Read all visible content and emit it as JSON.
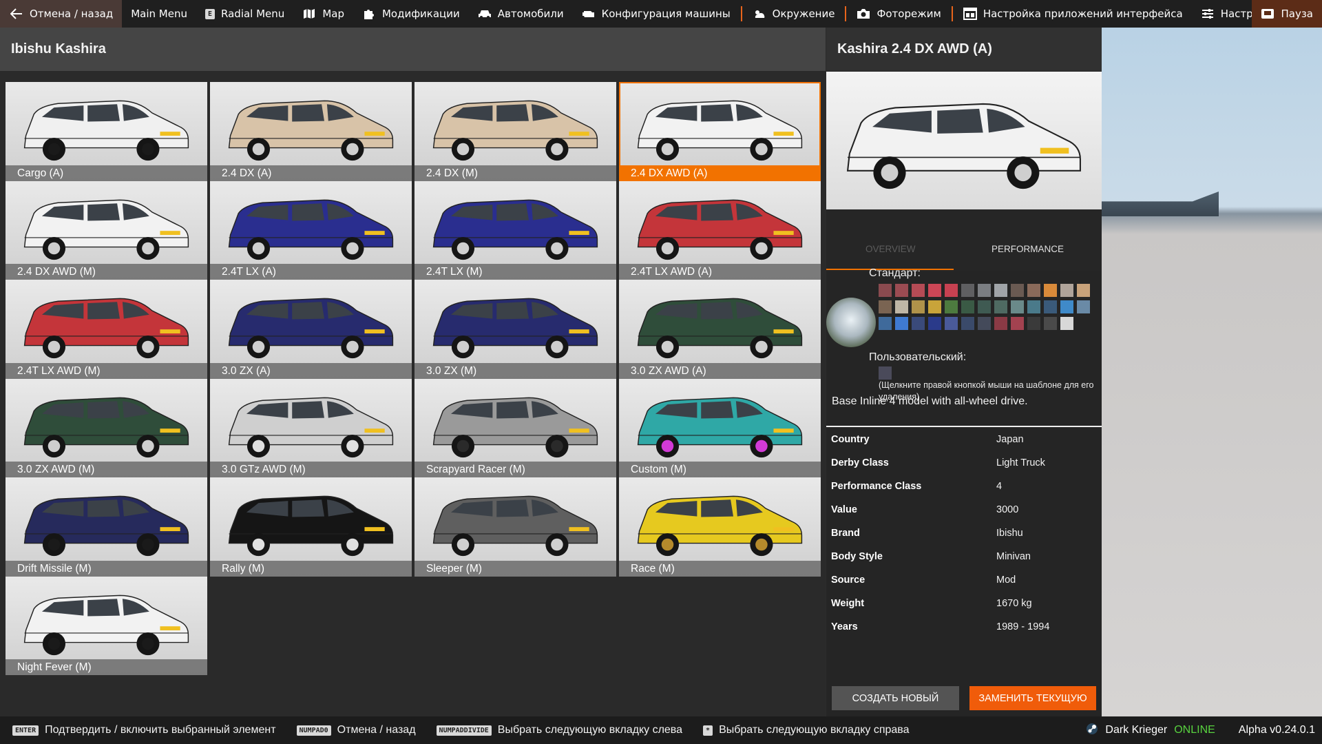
{
  "topbar": {
    "back_label": "Отмена / назад",
    "main_menu_label": "Main Menu",
    "radial_key": "E",
    "radial_label": "Radial Menu",
    "map_label": "Map",
    "mods_label": "Модификации",
    "vehicles_label": "Автомобили",
    "config_label": "Конфигурация машины",
    "environment_label": "Окружение",
    "photo_label": "Фоторежим",
    "ui_settings_label": "Настройка приложений интерфейса",
    "settings_label": "Настройки",
    "pause_label": "Пауза"
  },
  "grid_panel": {
    "title": "Ibishu Kashira",
    "tiles": [
      {
        "label": "Cargo (A)",
        "color": "#f0f0f0",
        "wheel": "#1a1a1a",
        "selected": false
      },
      {
        "label": "2.4 DX (A)",
        "color": "#d8c3a8",
        "wheel": "#cfcfcf",
        "selected": false
      },
      {
        "label": "2.4 DX (M)",
        "color": "#d8c3a8",
        "wheel": "#cfcfcf",
        "selected": false
      },
      {
        "label": "2.4 DX AWD (A)",
        "color": "#f2f2f2",
        "wheel": "#cfcfcf",
        "selected": true
      },
      {
        "label": "2.4 DX AWD (M)",
        "color": "#f2f2f2",
        "wheel": "#cfcfcf",
        "selected": false
      },
      {
        "label": "2.4T LX (A)",
        "color": "#2a2e8f",
        "wheel": "#cfcfcf",
        "selected": false
      },
      {
        "label": "2.4T LX (M)",
        "color": "#2a2e8f",
        "wheel": "#cfcfcf",
        "selected": false
      },
      {
        "label": "2.4T LX AWD (A)",
        "color": "#c4353a",
        "wheel": "#cfcfcf",
        "selected": false
      },
      {
        "label": "2.4T LX AWD (M)",
        "color": "#c4353a",
        "wheel": "#cfcfcf",
        "selected": false
      },
      {
        "label": "3.0 ZX (A)",
        "color": "#272b6e",
        "wheel": "#cfcfcf",
        "selected": false
      },
      {
        "label": "3.0 ZX (M)",
        "color": "#272b6e",
        "wheel": "#cfcfcf",
        "selected": false
      },
      {
        "label": "3.0 ZX AWD (A)",
        "color": "#2f4d3a",
        "wheel": "#cfcfcf",
        "selected": false
      },
      {
        "label": "3.0 ZX AWD (M)",
        "color": "#2f4d3a",
        "wheel": "#cfcfcf",
        "selected": false
      },
      {
        "label": "3.0 GTz AWD (M)",
        "color": "#cfcfcf",
        "wheel": "#e0e0e0",
        "selected": false
      },
      {
        "label": "Scrapyard Racer (M)",
        "color": "#9a9a9a",
        "wheel": "#2a2a2a",
        "selected": false
      },
      {
        "label": "Custom (M)",
        "color": "#2fa8a6",
        "wheel": "#d23ad6",
        "selected": false
      },
      {
        "label": "Drift Missile (M)",
        "color": "#262a5c",
        "wheel": "#1a1a1a",
        "selected": false
      },
      {
        "label": "Rally (M)",
        "color": "#151515",
        "wheel": "#e0e0e0",
        "selected": false
      },
      {
        "label": "Sleeper (M)",
        "color": "#5f5f5f",
        "wheel": "#cfcfcf",
        "selected": false
      },
      {
        "label": "Race (M)",
        "color": "#e6c91f",
        "wheel": "#b58a2c",
        "selected": false
      },
      {
        "label": "Night Fever (M)",
        "color": "#f2f2f2",
        "wheel": "#1a1a1a",
        "selected": false
      }
    ]
  },
  "detail": {
    "title": "Kashira 2.4 DX AWD (A)",
    "preview_color": "#f2f2f2",
    "tabs": {
      "overview": "OVERVIEW",
      "performance": "PERFORMANCE"
    },
    "paint": {
      "standard_label": "Стандарт:",
      "custom_label": "Пользовательский:",
      "note": "(Щелкните правой кнопкой мыши на шаблоне для его удаления)",
      "standard_swatches": [
        "#8a4a4f",
        "#9b4b52",
        "#b54b55",
        "#cc4656",
        "#c74151",
        "#5f5f61",
        "#7b7e82",
        "#a0a4a8",
        "#6a5a52",
        "#8a6a5a",
        "#d98a3a",
        "#b0a49a",
        "#c8a27a",
        "#7a6452",
        "#bfb6a6",
        "#b0924a",
        "#c9a43a",
        "#4d7a3f",
        "#3a5a45",
        "#3f5a52",
        "#4f6a62",
        "#6a8a8a",
        "#4a7a8a",
        "#3a5a7a",
        "#3f8ac9",
        "#6a8aa6",
        "#3f6a9b",
        "#3f7ad2",
        "#3a4a7a",
        "#2a3a8a",
        "#4a5a9a",
        "#3a4a6a",
        "#444a5a",
        "#8a3a45",
        "#a34250",
        "#3a3a3a",
        "#4a4a4a",
        "#d8d8d8"
      ],
      "custom_swatches": [
        "#4a4a5a"
      ]
    },
    "description": "Base Inline 4 model with all-wheel drive.",
    "specs": [
      {
        "key": "Country",
        "value": "Japan"
      },
      {
        "key": "Derby Class",
        "value": "Light Truck"
      },
      {
        "key": "Performance Class",
        "value": "4"
      },
      {
        "key": "Value",
        "value": "3000"
      },
      {
        "key": "Brand",
        "value": "Ibishu"
      },
      {
        "key": "Body Style",
        "value": "Minivan"
      },
      {
        "key": "Source",
        "value": "Mod"
      },
      {
        "key": "Weight",
        "value": "1670 kg"
      },
      {
        "key": "Years",
        "value": "1989 - 1994"
      }
    ],
    "buttons": {
      "new": "СОЗДАТЬ НОВЫЙ",
      "replace": "ЗАМЕНИТЬ ТЕКУЩУЮ"
    }
  },
  "bottombar": {
    "confirm_key": "ENTER",
    "confirm_label": "Подтвердить / включить выбранный элемент",
    "cancel_key": "NUMPAD0",
    "cancel_label": "Отмена / назад",
    "prev_tab_key": "NUMPADDIVIDE",
    "prev_tab_label": "Выбрать следующую вкладку слева",
    "next_tab_key": "*",
    "next_tab_label": "Выбрать следующую вкладку справа",
    "username": "Dark Krieger",
    "status": "ONLINE",
    "version": "Alpha v0.24.0.1"
  },
  "colors": {
    "accent": "#f27200",
    "online": "#58d23f"
  }
}
